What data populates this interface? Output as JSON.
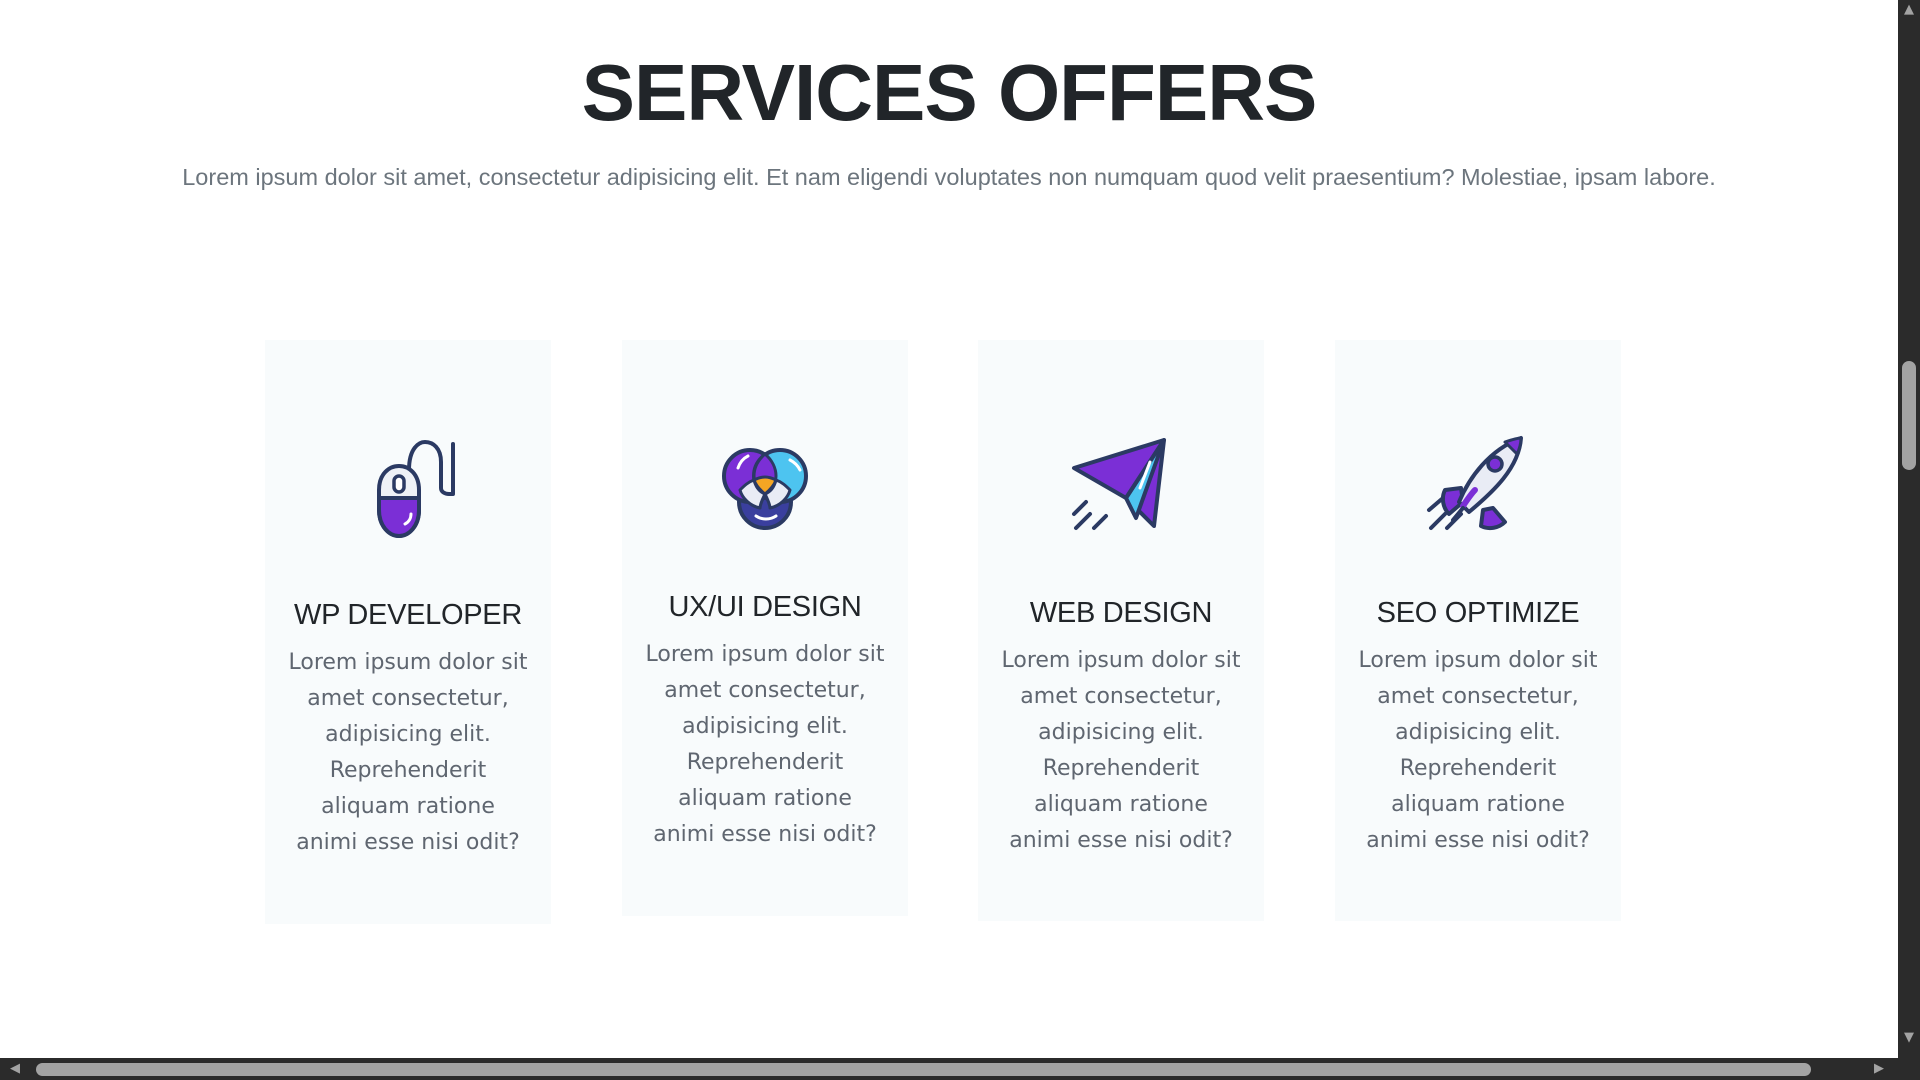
{
  "section": {
    "title": "SERVICES OFFERS",
    "subtitle": "Lorem ipsum dolor sit amet, consectetur adipisicing elit. Et nam eligendi voluptates non numquam quod velit praesentium? Molestiae, ipsam labore."
  },
  "cards": [
    {
      "icon": "mouse-icon",
      "title": "WP DEVELOPER",
      "text": "Lorem ipsum dolor sit amet consectetur, adipisicing elit. Reprehenderit aliquam ratione animi esse nisi odit?"
    },
    {
      "icon": "color-circles-icon",
      "title": "UX/UI DESIGN",
      "text": "Lorem ipsum dolor sit amet consectetur, adipisicing elit. Reprehenderit aliquam ratione animi esse nisi odit?"
    },
    {
      "icon": "paper-plane-icon",
      "title": "WEB DESIGN",
      "text": "Lorem ipsum dolor sit amet consectetur, adipisicing elit. Reprehenderit aliquam ratione animi esse nisi odit?"
    },
    {
      "icon": "rocket-icon",
      "title": "SEO OPTIMIZE",
      "text": "Lorem ipsum dolor sit amet consectetur, adipisicing elit. Reprehenderit aliquam ratione animi esse nisi odit?"
    }
  ],
  "colors": {
    "accent_purple": "#7b2fd6",
    "accent_blue": "#4dc4f0",
    "accent_orange": "#f5a623",
    "outline": "#2b3a63",
    "card_bg": "#f8fbfc"
  }
}
